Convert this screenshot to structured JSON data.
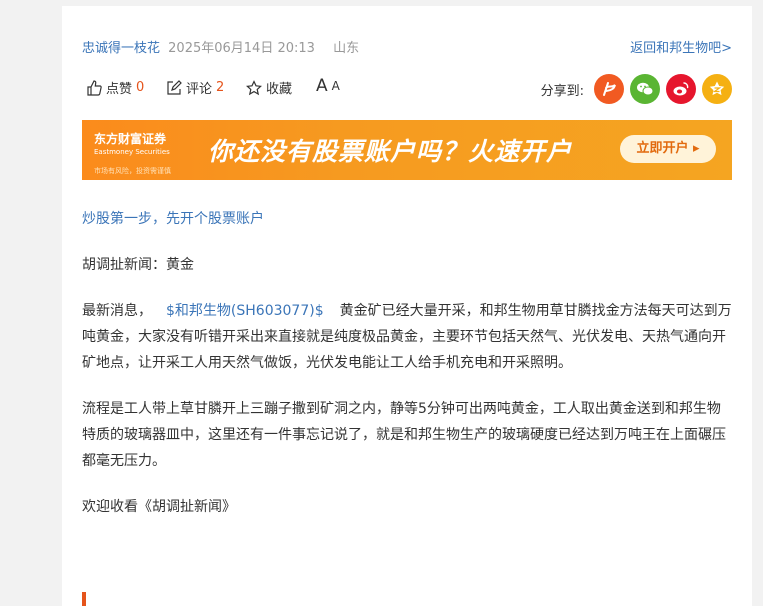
{
  "header": {
    "author": "忠诚得一枝花",
    "time": "2025年06月14日 20:13",
    "location": "山东",
    "back_link": "返回和邦生物吧>"
  },
  "actions": {
    "like_label": "点赞",
    "like_count": "0",
    "comment_label": "评论",
    "comment_count": "2",
    "favorite_label": "收藏",
    "font_size_label": "A",
    "font_size_small": "A",
    "share_label": "分享到:"
  },
  "share_icons": [
    "flag-icon",
    "wechat-icon",
    "weibo-icon",
    "qzone-icon"
  ],
  "banner": {
    "logo_text": "东方财富证券",
    "logo_en": "Eastmoney Securities",
    "risk_text": "市场有风险，投资需谨慎",
    "slogan": "你还没有股票账户吗？火速开户",
    "button": "立即开户 ▸"
  },
  "content": {
    "link": "炒股第一步，先开个股票账户",
    "p1": "胡调扯新闻：黄金",
    "p2_prefix": "最新消息，",
    "stock": "$和邦生物(SH603077)$",
    "p2_body": "黄金矿已经大量开采，和邦生物用草甘膦找金方法每天可达到万吨黄金，大家没有听错开采出来直接就是纯度极品黄金，主要环节包括天然气、光伏发电、天热气通向开矿地点，让开采工人用天然气做饭，光伏发电能让工人给手机充电和开采照明。",
    "p3": "流程是工人带上草甘膦开上三蹦子撒到矿洞之内，静等5分钟可出两吨黄金，工人取出黄金送到和邦生物特质的玻璃器皿中，这里还有一件事忘记说了，就是和邦生物生产的玻璃硬度已经达到万吨王在上面碾压都毫无压力。",
    "p4": "欢迎收看《胡调扯新闻》"
  },
  "colors": {
    "accent_blue": "#3b75b8",
    "count_orange": "#e5541b",
    "banner_orange": "#f69a20"
  }
}
